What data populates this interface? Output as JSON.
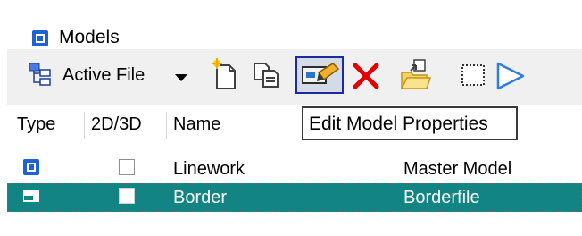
{
  "window": {
    "title": "Models"
  },
  "toolbar": {
    "active_file_label": "Active File",
    "buttons": [
      {
        "name": "new-model",
        "icon": "new-document-icon"
      },
      {
        "name": "copy-model",
        "icon": "copy-icon"
      },
      {
        "name": "edit-model-properties",
        "icon": "edit-properties-icon"
      },
      {
        "name": "delete-model",
        "icon": "delete-icon"
      },
      {
        "name": "import-model",
        "icon": "import-folder-icon"
      },
      {
        "name": "select-area",
        "icon": "dotted-rectangle-icon"
      },
      {
        "name": "triangle-tool",
        "icon": "triangle-icon"
      }
    ]
  },
  "tooltip": {
    "text": "Edit Model Properties"
  },
  "table": {
    "headers": {
      "type": "Type",
      "dim": "2D/3D",
      "name": "Name",
      "description": ""
    },
    "rows": [
      {
        "name": "Linework",
        "description": "Master Model",
        "selected": false,
        "type_icon": "model-icon"
      },
      {
        "name": "Border",
        "description": "Borderfile",
        "selected": true,
        "type_icon": "sheet-model-icon"
      }
    ]
  },
  "colors": {
    "selected_row": "#128483",
    "accent_blue": "#1f5fd1"
  }
}
